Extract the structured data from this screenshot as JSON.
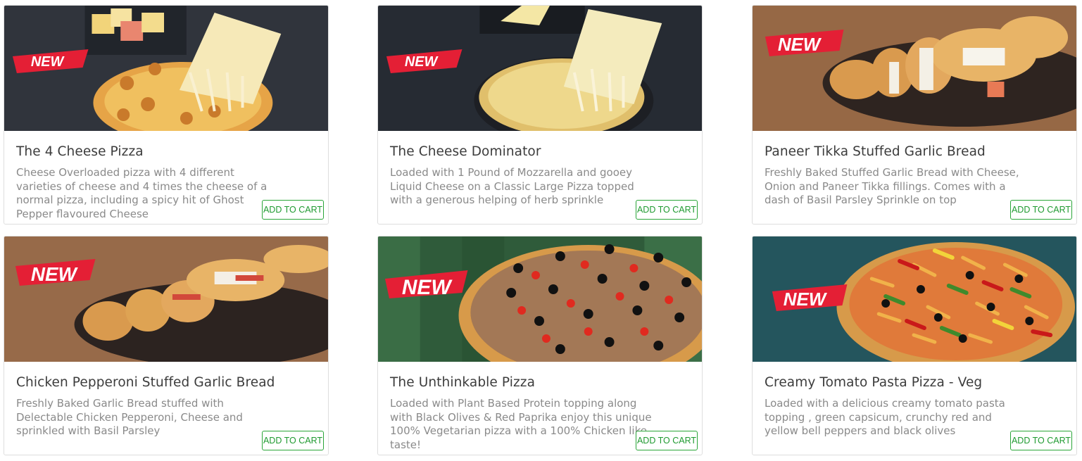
{
  "cards": [
    {
      "title": "The 4 Cheese Pizza",
      "description": "Cheese Overloaded pizza with 4 different varieties of cheese and 4 times the cheese of a normal pizza, including a spicy hit of Ghost Pepper flavoured Cheese",
      "badge": "NEW",
      "button": "ADD TO CART"
    },
    {
      "title": "The Cheese Dominator",
      "description": "Loaded with 1 Pound of Mozzarella and gooey Liquid Cheese on a Classic Large Pizza topped with a generous helping of herb sprinkle",
      "badge": "NEW",
      "button": "ADD TO CART"
    },
    {
      "title": "Paneer Tikka Stuffed Garlic Bread",
      "description": "Freshly Baked Stuffed Garlic Bread with Cheese, Onion and Paneer Tikka fillings. Comes with a dash of Basil Parsley Sprinkle on top",
      "badge": "NEW",
      "button": "ADD TO CART"
    },
    {
      "title": "Chicken Pepperoni Stuffed Garlic Bread",
      "description": "Freshly Baked Garlic Bread stuffed with Delectable Chicken Pepperoni, Cheese and sprinkled with Basil Parsley",
      "badge": "NEW",
      "button": "ADD TO CART"
    },
    {
      "title": "The Unthinkable Pizza",
      "description": "Loaded with Plant Based Protein topping along with Black Olives & Red Paprika enjoy this unique 100% Vegetarian pizza with a 100% Chicken like taste!",
      "badge": "NEW",
      "button": "ADD TO CART"
    },
    {
      "title": "Creamy Tomato Pasta Pizza - Veg",
      "description": "Loaded with a delicious creamy tomato pasta topping , green capsicum, crunchy red and yellow bell peppers and black olives",
      "badge": "NEW",
      "button": "ADD TO CART"
    }
  ],
  "colors": {
    "button_green": "#1f9a30",
    "badge_red": "#e41f35",
    "title": "#3c3c3c",
    "description": "#8a8a8a"
  }
}
